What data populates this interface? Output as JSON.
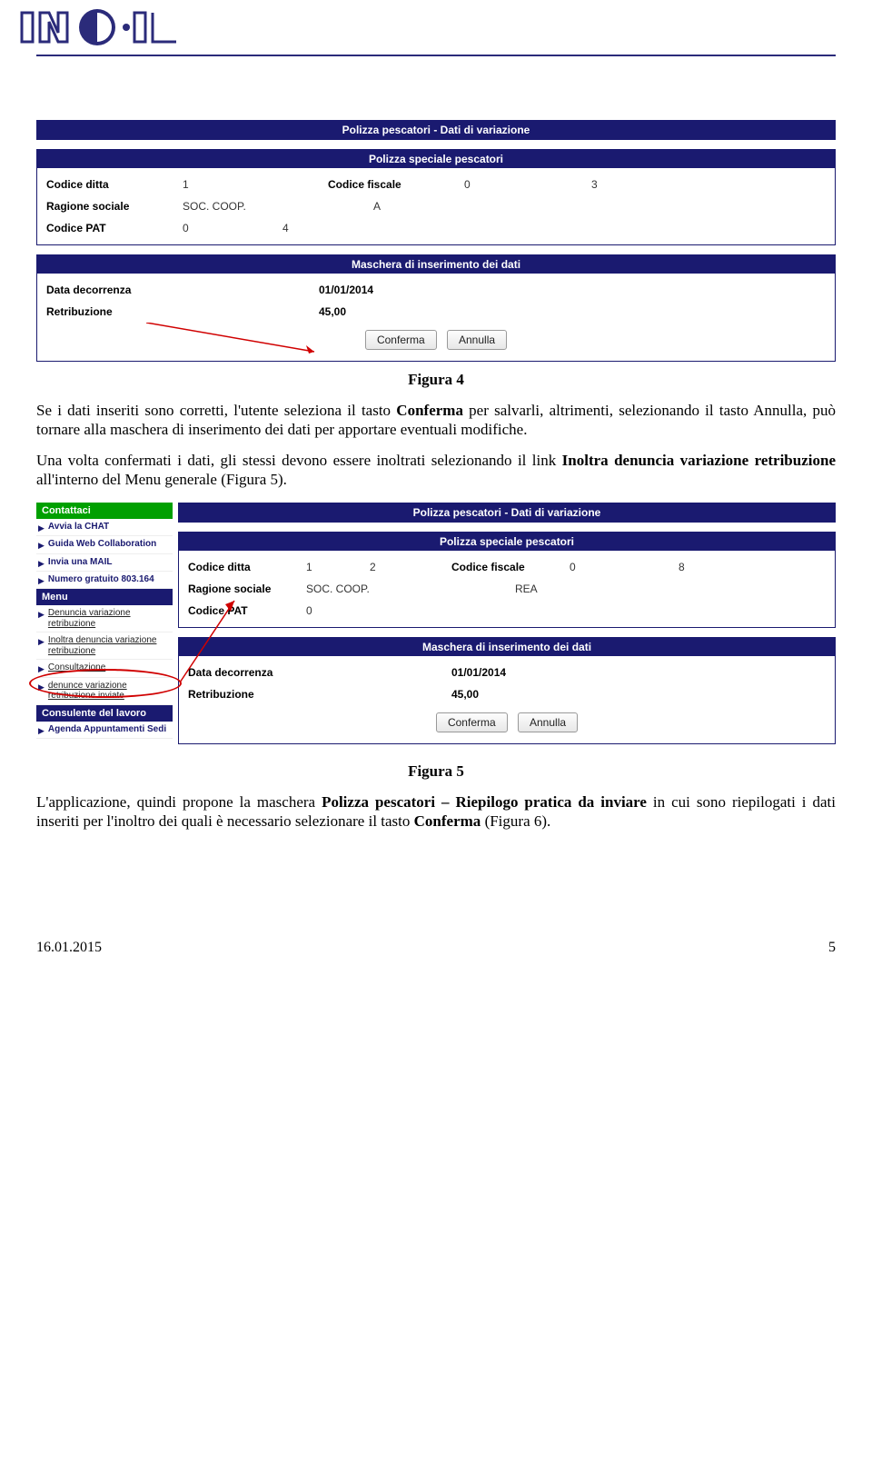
{
  "logo_text": "INAIL",
  "fig4": {
    "label": "Figura 4",
    "panel1_title": "Polizza pescatori - Dati di variazione",
    "panel2_title": "Polizza speciale pescatori",
    "codice_ditta_lbl": "Codice ditta",
    "codice_ditta_val1": "1",
    "codice_ditta_val2": "",
    "codice_fiscale_lbl": "Codice fiscale",
    "codice_fiscale_val1": "0",
    "codice_fiscale_val2": "3",
    "ragione_lbl": "Ragione sociale",
    "ragione_val": "SOC. COOP.",
    "ragione_val_mid": "",
    "ragione_val_end": "A",
    "codice_pat_lbl": "Codice PAT",
    "codice_pat_val1": "0",
    "codice_pat_val2": "4",
    "panel3_title": "Maschera di inserimento dei dati",
    "data_dec_lbl": "Data decorrenza",
    "data_dec_val": "01/01/2014",
    "retr_lbl": "Retribuzione",
    "retr_val": "45,00",
    "btn_conferma": "Conferma",
    "btn_annulla": "Annulla"
  },
  "para1": "Se i dati inseriti sono corretti, l'utente seleziona il tasto <strong>Conferma</strong> per salvarli, altrimenti, selezionando il tasto Annulla, può tornare alla maschera di inserimento dei dati per apportare eventuali modifiche.",
  "para2": "Una volta confermati i dati, gli stessi devono essere inoltrati selezionando il link <strong>Inoltra denuncia variazione retribuzione</strong> all'interno del Menu generale (Figura 5).",
  "sidebar": {
    "contattaci": "Contattaci",
    "items_contatti": [
      "Avvia la CHAT",
      "Guida Web Collaboration",
      "Invia una MAIL",
      "Numero gratuito 803.164"
    ],
    "menu": "Menu",
    "items_menu": [
      "Denuncia variazione retribuzione",
      "Inoltra denuncia variazione retribuzione",
      "Consultazione",
      "denunce variazione retribuzione inviate"
    ],
    "consulente": "Consulente del lavoro",
    "items_cons": [
      "Agenda Appuntamenti Sedi"
    ]
  },
  "fig5": {
    "label": "Figura 5",
    "panel1_title": "Polizza pescatori - Dati di variazione",
    "panel2_title": "Polizza speciale pescatori",
    "codice_ditta_val1": "1",
    "codice_ditta_val2": "2",
    "codice_fiscale_val1": "0",
    "codice_fiscale_val2": "8",
    "ragione_val": "SOC. COOP.",
    "ragione_val_end": "REA",
    "codice_pat_val1": "0",
    "panel3_title": "Maschera di inserimento dei dati",
    "data_dec_val": "01/01/2014",
    "retr_val": "45,00",
    "btn_conferma": "Conferma",
    "btn_annulla": "Annulla"
  },
  "para3": "L'applicazione, quindi propone la maschera <strong>Polizza pescatori – Riepilogo pratica da inviare</strong> in cui sono riepilogati i dati inseriti per l'inoltro dei quali è necessario selezionare il tasto <strong>Conferma</strong> (Figura 6).",
  "footer": {
    "date": "16.01.2015",
    "page": "5"
  }
}
